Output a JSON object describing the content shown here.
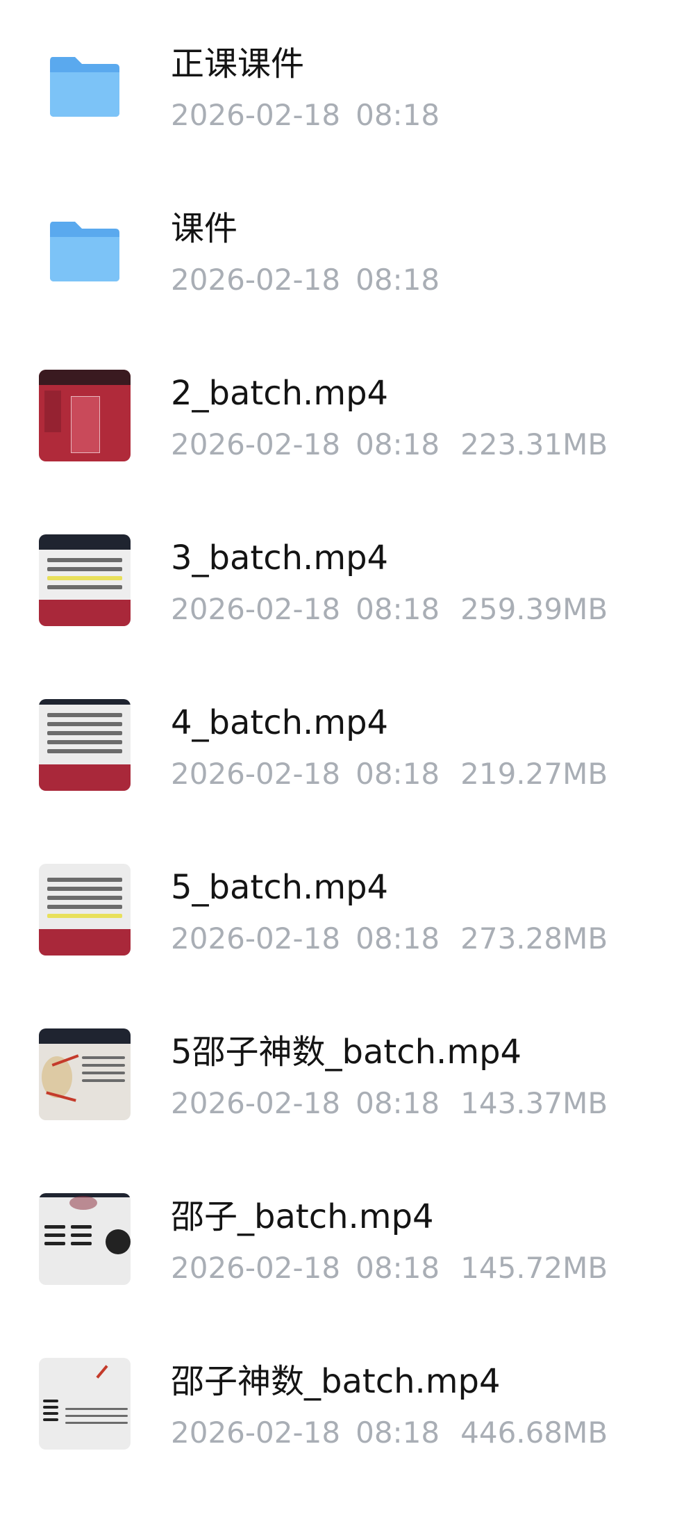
{
  "items": [
    {
      "type": "folder",
      "name": "正课课件",
      "date": "2026-02-18",
      "time": "08:18",
      "size": ""
    },
    {
      "type": "folder",
      "name": "课件",
      "date": "2026-02-18",
      "time": "08:18",
      "size": ""
    },
    {
      "type": "video",
      "name": "2_batch.mp4",
      "date": "2026-02-18",
      "time": "08:18",
      "size": "223.31MB"
    },
    {
      "type": "video",
      "name": "3_batch.mp4",
      "date": "2026-02-18",
      "time": "08:18",
      "size": "259.39MB"
    },
    {
      "type": "video",
      "name": "4_batch.mp4",
      "date": "2026-02-18",
      "time": "08:18",
      "size": "219.27MB"
    },
    {
      "type": "video",
      "name": "5_batch.mp4",
      "date": "2026-02-18",
      "time": "08:18",
      "size": "273.28MB"
    },
    {
      "type": "video",
      "name": "5邵子神数_batch.mp4",
      "date": "2026-02-18",
      "time": "08:18",
      "size": "143.37MB"
    },
    {
      "type": "video",
      "name": "邵子_batch.mp4",
      "date": "2026-02-18",
      "time": "08:18",
      "size": "145.72MB"
    },
    {
      "type": "video",
      "name": "邵子神数_batch.mp4",
      "date": "2026-02-18",
      "time": "08:18",
      "size": "446.68MB"
    }
  ],
  "colors": {
    "folder": "#5fb6f5",
    "thumb_red": "#b02a3a",
    "thumb_dark": "#1f2430",
    "title": "#141414",
    "meta": "#a9aeb5"
  },
  "icons": {
    "folder": "folder-icon",
    "video": "video-thumbnail"
  }
}
